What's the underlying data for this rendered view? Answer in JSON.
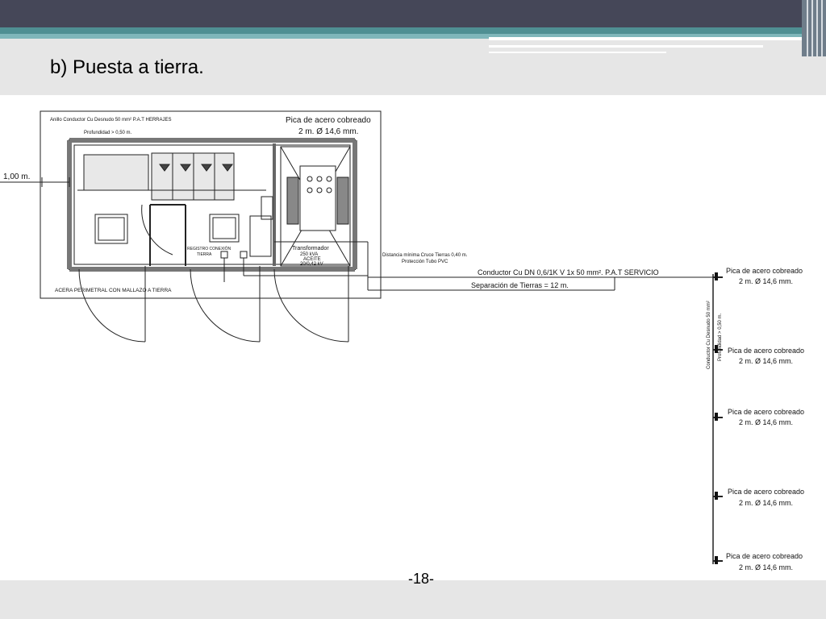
{
  "slide": {
    "title": "b) Puesta a tierra.",
    "page_number": "-18-"
  },
  "plan": {
    "dim_label": "1,00 m.",
    "anillo_label": "Anillo Conductor Cu Desnudo 50 mm² P.A.T HERRAJES",
    "profundidad_label": "Profundidad > 0,50 m.",
    "pica_top_line1": "Pica de acero cobreado",
    "pica_top_line2": "2 m. Ø 14,6 mm.",
    "acera_label": "ACERA PERIMETRAL CON MALLAZO A TIERRA",
    "registro_label_1": "REGISTRO  CONEXIÓN",
    "registro_label_2": "TIERRA",
    "trafo_line1": "Transformador",
    "trafo_line2": "250  kVA",
    "trafo_line3": "ACEITE",
    "trafo_line4": "20/0,42  kV",
    "cruce_line1": "Distancia mínima Cruce Tierras 0,40 m.",
    "cruce_line2": "Protección Tubo PVC",
    "conductor_servicio": "Conductor Cu DN 0,6/1K V 1x 50 mm². P.A.T SERVICIO",
    "separacion": "Separación de Tierras = 12 m.",
    "vertical_label_1": "Conductor Cu Desnudo 50 mm²",
    "vertical_label_2": "Profundidad > 0,50 m.",
    "picas": [
      {
        "line1": "Pica de acero cobreado",
        "line2": "2 m. Ø 14,6 mm."
      },
      {
        "line1": "Pica de acero cobreado",
        "line2": "2 m. Ø 14,6 mm."
      },
      {
        "line1": "Pica de acero cobreado",
        "line2": "2 m. Ø 14,6 mm."
      },
      {
        "line1": "Pica de acero cobreado",
        "line2": "2 m. Ø 14,6 mm."
      },
      {
        "line1": "Pica de acero cobreado",
        "line2": "2 m. Ø 14,6 mm."
      }
    ]
  }
}
